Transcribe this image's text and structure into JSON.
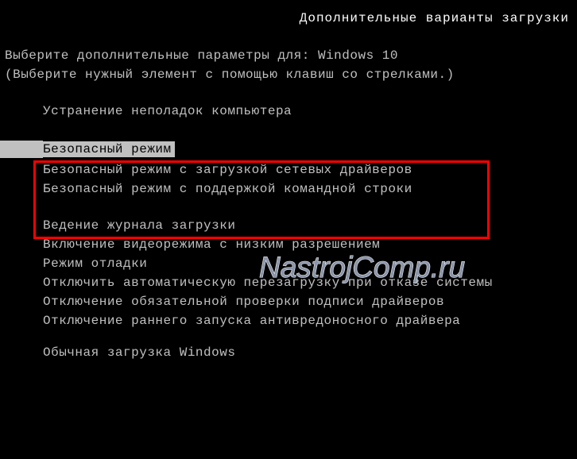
{
  "title": "Дополнительные варианты загрузки",
  "prompt_prefix": "Выберите дополнительные параметры для: ",
  "os_name": "Windows 10",
  "hint": "(Выберите нужный элемент с помощью клавиш со стрелками.)",
  "options": {
    "repair": "Устранение неполадок компьютера",
    "safe_mode": "Безопасный режим",
    "safe_mode_net": "Безопасный режим с загрузкой сетевых драйверов",
    "safe_mode_cmd": "Безопасный режим с поддержкой командной строки",
    "boot_logging": "Ведение журнала загрузки",
    "low_res": "Включение видеорежима с низким разрешением",
    "debug_mode": "Режим отладки",
    "disable_auto_restart": "Отключить автоматическую перезагрузку при отказе системы",
    "disable_sig_enforce": "Отключение обязательной проверки подписи драйверов",
    "disable_elam": "Отключение раннего запуска антивредоносного драйвера",
    "normal": "Обычная загрузка Windows"
  },
  "watermark": "NastrojComp.ru"
}
